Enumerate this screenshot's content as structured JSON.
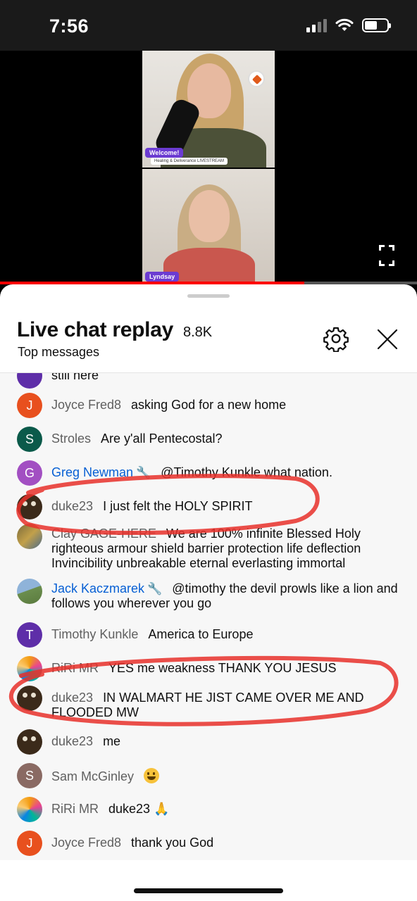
{
  "status_bar": {
    "time": "7:56",
    "signal_icon": "signal-bars-icon",
    "wifi_icon": "wifi-icon",
    "battery_icon": "battery-icon",
    "battery_level": 0.55
  },
  "video": {
    "badge_welcome": "Welcome!",
    "badge_subtitle": "Healing & Deliverance LIVESTREAM",
    "name_tag": "Lyndsay",
    "fullscreen_icon": "fullscreen-icon",
    "progress": 0.73,
    "progress_color": "#ff0000"
  },
  "header": {
    "title": "Live chat replay",
    "viewer_count": "8.8K",
    "subtitle": "Top messages",
    "settings_icon": "gear-icon",
    "close_icon": "close-icon"
  },
  "chat": {
    "partial_top": "still here",
    "messages": [
      {
        "author": "Joyce Fred8",
        "text": "asking God for a new home",
        "avatar_letter": "J",
        "avatar_color": "#e8501e"
      },
      {
        "author": "Stroles",
        "text": "Are y'all Pentecostal?",
        "avatar_letter": "S",
        "avatar_color": "#0b5a4a"
      },
      {
        "author": "Greg Newman",
        "text": "@Timothy Kunkle what nation.",
        "avatar_letter": "G",
        "avatar_color": "#a24fc2",
        "moderator": true
      },
      {
        "author": "duke23",
        "text": "I just felt the HOLY SPIRIT"
      },
      {
        "author": "Clay GAGE-HERE",
        "text": "We are 100% infinite Blessed Holy righteous armour shield barrier protection life deflection Invincibility unbreakable eternal everlasting immortal"
      },
      {
        "author": "Jack Kaczmarek",
        "text": "@timothy the devil prowls like a lion and follows you wherever you go",
        "moderator": true
      },
      {
        "author": "Timothy Kunkle",
        "text": "America to Europe",
        "avatar_letter": "T",
        "avatar_color": "#5e2ea8"
      },
      {
        "author": "RiRi MR",
        "text": "YES me weakness THANK YOU JESUS"
      },
      {
        "author": "duke23",
        "text": "IN WALMART HE JIST CAME OVER ME AND FLOODED MW"
      },
      {
        "author": "duke23",
        "text": "me"
      },
      {
        "author": "Sam McGinley",
        "text": "",
        "avatar_letter": "S",
        "avatar_color": "#8a6a63",
        "emoji": "grinning-face-emoji"
      },
      {
        "author": "RiRi MR",
        "text": "duke23",
        "emoji": "folded-hands-emoji"
      },
      {
        "author": "Joyce Fred8",
        "text": "thank you God",
        "avatar_letter": "J",
        "avatar_color": "#e8501e"
      }
    ],
    "mod_icon": "wrench-icon",
    "annotation_color": "#e8302a"
  }
}
